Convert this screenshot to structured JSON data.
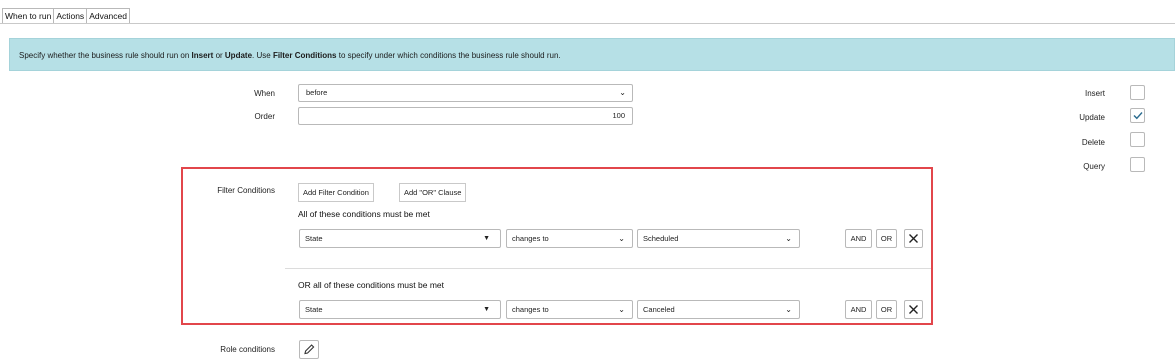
{
  "tabs": [
    "When to run",
    "Actions",
    "Advanced"
  ],
  "banner": {
    "p1": "Specify whether the business rule should run on ",
    "b1": "Insert",
    "p2": " or ",
    "b2": "Update",
    "p3": ". Use ",
    "b3": "Filter Conditions",
    "p4": " to specify under which conditions the business rule should run."
  },
  "form": {
    "when_label": "When",
    "when_value": "before",
    "order_label": "Order",
    "order_value": "100"
  },
  "checkboxes": [
    {
      "label": "Insert",
      "checked": false
    },
    {
      "label": "Update",
      "checked": true
    },
    {
      "label": "Delete",
      "checked": false
    },
    {
      "label": "Query",
      "checked": false
    }
  ],
  "filter": {
    "label": "Filter Conditions",
    "add_filter": "Add Filter Condition",
    "add_or": "Add \"OR\" Clause",
    "group1_hint": "All of these conditions must be met",
    "group2_hint": "OR all of these conditions must be met",
    "rows": [
      {
        "field": "State",
        "operator": "changes to",
        "value": "Scheduled"
      },
      {
        "field": "State",
        "operator": "changes to",
        "value": "Canceled"
      }
    ],
    "and_label": "AND",
    "or_label": "OR"
  },
  "role_conditions_label": "Role conditions",
  "colors": {
    "banner": "#b6e0e6",
    "highlight_box": "#e2464b",
    "check": "#2b6c8f"
  }
}
